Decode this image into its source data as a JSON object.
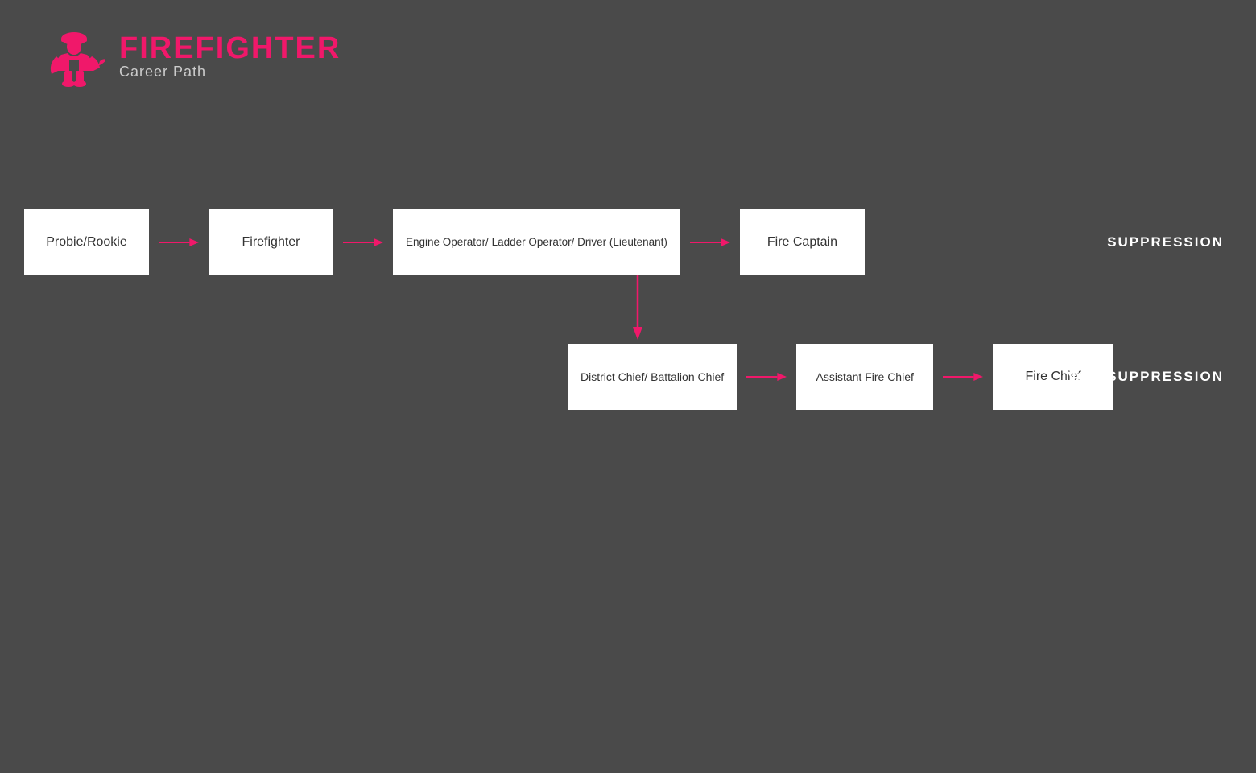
{
  "header": {
    "title": "FIREFIGHTER",
    "subtitle": "Career Path"
  },
  "suppression": {
    "label": "SUPPRESSION",
    "nodes": [
      {
        "id": "probie",
        "text": "Probie/Rookie"
      },
      {
        "id": "firefighter",
        "text": "Firefighter"
      },
      {
        "id": "engine-operator",
        "text": "Engine Operator/ Ladder Operator/ Driver (Lieutenant)"
      },
      {
        "id": "fire-captain",
        "text": "Fire Captain"
      }
    ]
  },
  "non_suppression": {
    "label": "NON-SUPPRESSION",
    "nodes": [
      {
        "id": "district-chief",
        "text": "District Chief/ Battalion Chief"
      },
      {
        "id": "assistant-fire-chief",
        "text": "Assistant Fire Chief"
      },
      {
        "id": "fire-chief",
        "text": "Fire Chief"
      }
    ]
  },
  "arrows": {
    "color": "#f0186a",
    "horizontal": "→",
    "vertical": "↓"
  }
}
